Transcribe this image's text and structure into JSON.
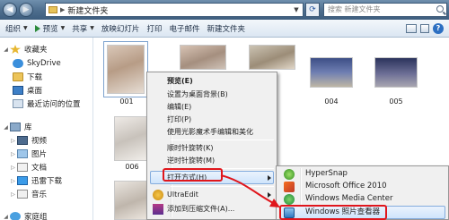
{
  "address": {
    "path": "新建文件夹"
  },
  "search": {
    "placeholder": "搜索 新建文件夹"
  },
  "commands": {
    "organize": "组织",
    "preview": "预览",
    "share": "共享",
    "slideshow": "放映幻灯片",
    "print": "打印",
    "email": "电子邮件",
    "new_folder": "新建文件夹"
  },
  "nav": {
    "favorites": "收藏夹",
    "skydrive": "SkyDrive",
    "downloads": "下载",
    "desktop": "桌面",
    "recent": "最近访问的位置",
    "libraries": "库",
    "videos": "视频",
    "pictures": "图片",
    "documents": "文档",
    "thunder": "迅雷下载",
    "music": "音乐",
    "homegroup": "家庭组"
  },
  "files": [
    {
      "name": "001"
    },
    {
      "name": "004"
    },
    {
      "name": "005"
    },
    {
      "name": "006"
    }
  ],
  "context_menu": {
    "items": [
      "预览(E)",
      "设置为桌面背景(B)",
      "编辑(E)",
      "打印(P)",
      "使用光影魔术手编辑和美化",
      "顺时针旋转(K)",
      "逆时针旋转(M)",
      "打开方式(H)",
      "UltraEdit",
      "添加到压缩文件(A)..."
    ],
    "highlighted": "打开方式(H)"
  },
  "submenu": {
    "items": [
      "HyperSnap",
      "Microsoft Office 2010",
      "Windows Media Center",
      "Windows 照片查看器"
    ],
    "highlighted": "Windows 照片查看器"
  },
  "colors": {
    "titlebar": "#4d6d8d",
    "annotation": "#e0161c",
    "menu_highlight": "#cfe4fb"
  }
}
